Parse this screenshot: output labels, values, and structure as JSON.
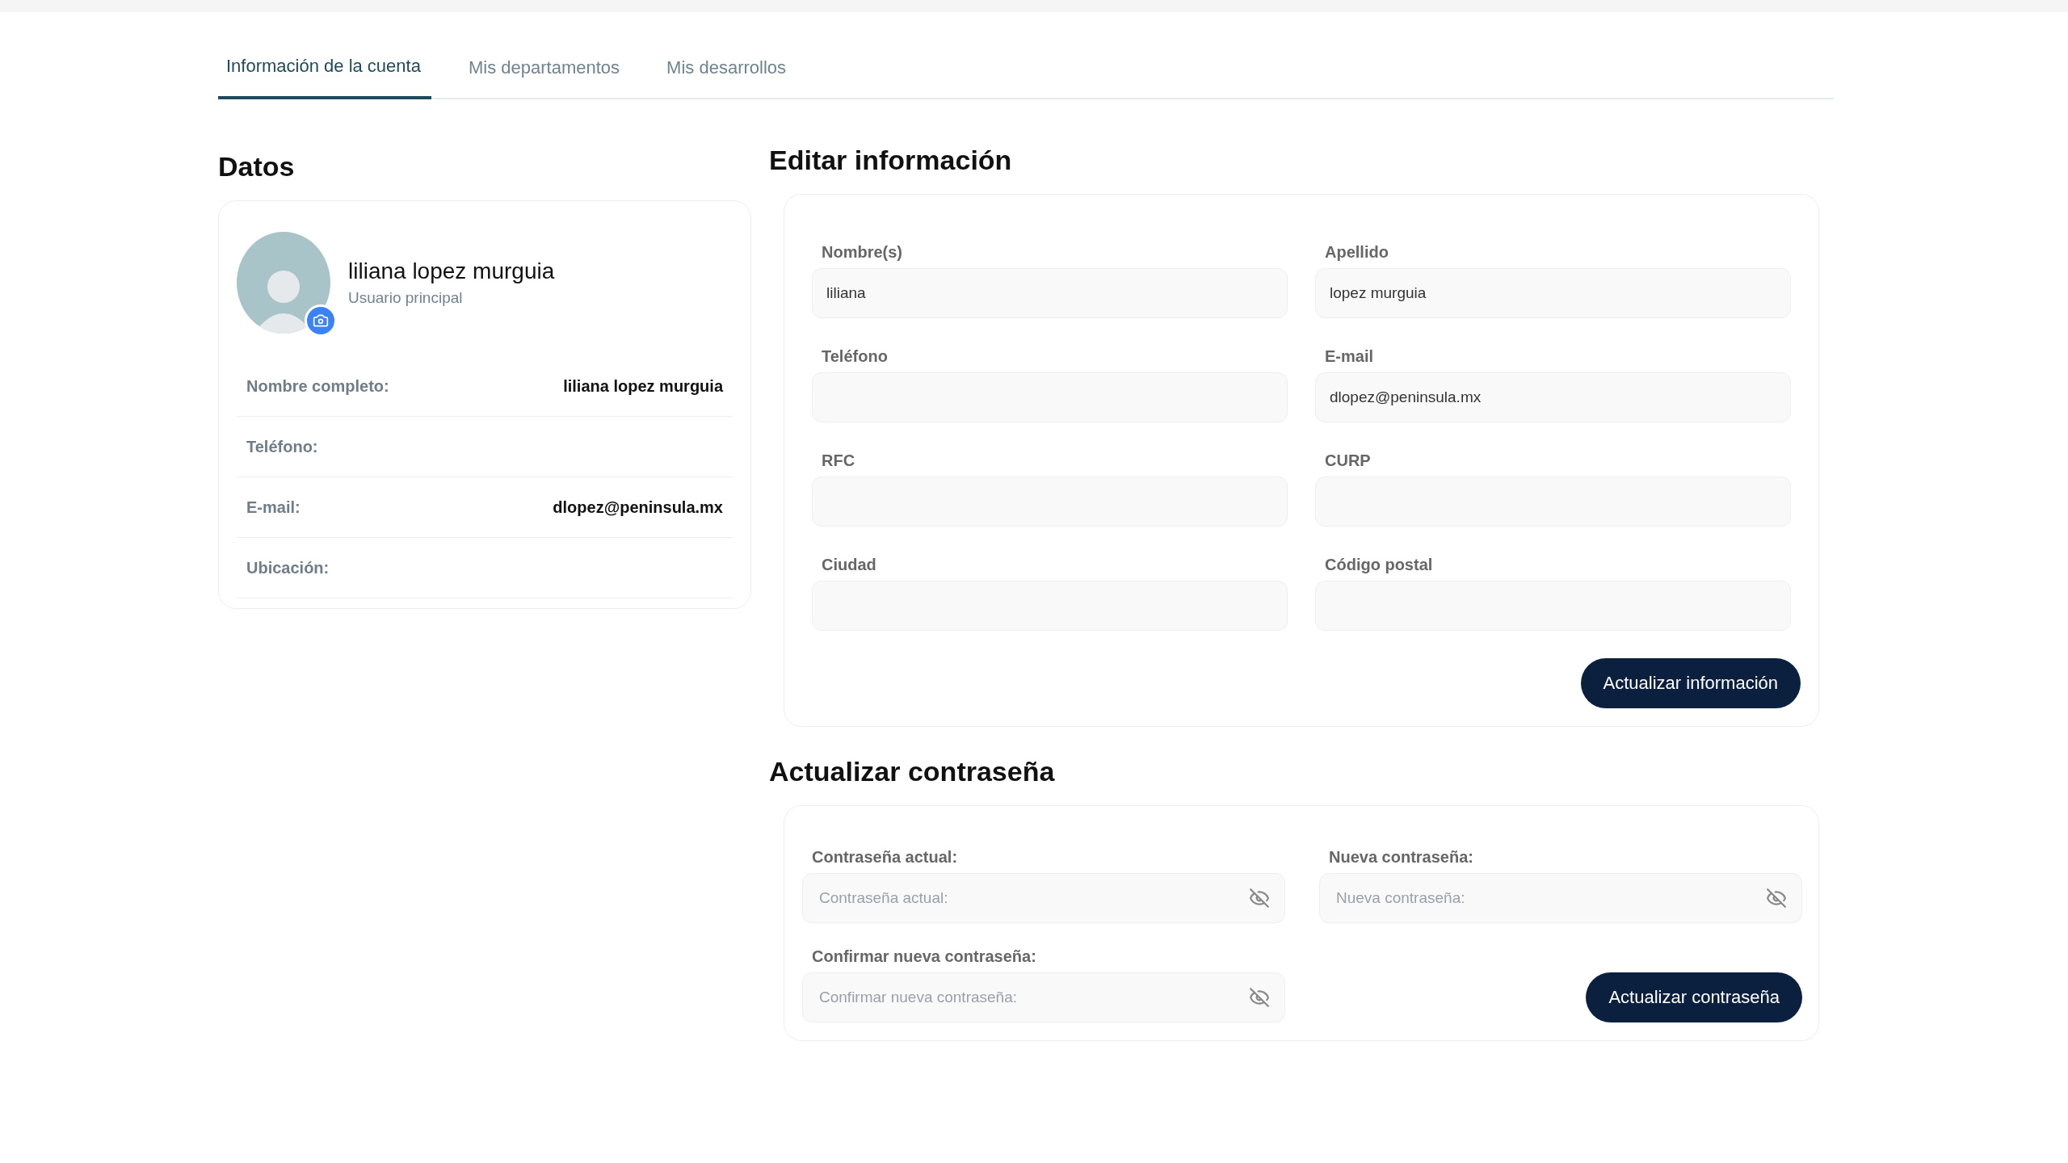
{
  "tabs": [
    {
      "label": "Información de la cuenta",
      "selected": true
    },
    {
      "label": "Mis departamentos",
      "selected": false
    },
    {
      "label": "Mis desarrollos",
      "selected": false
    }
  ],
  "profile": {
    "heading": "Datos",
    "name": "liliana lopez murguia",
    "role": "Usuario principal",
    "rows": [
      {
        "label": "Nombre completo:",
        "value": "liliana lopez murguia"
      },
      {
        "label": "Teléfono:"
      },
      {
        "label": "E-mail:",
        "value": "dlopez@peninsula.mx"
      },
      {
        "label": "Ubicación:"
      }
    ]
  },
  "edit": {
    "heading": "Editar información",
    "fields": [
      {
        "label": "Nombre(s)",
        "value": "liliana"
      },
      {
        "label": "Apellido",
        "value": "lopez murguia"
      },
      {
        "label": "Teléfono"
      },
      {
        "label": "E-mail",
        "value": "dlopez@peninsula.mx"
      },
      {
        "label": "RFC"
      },
      {
        "label": "CURP"
      },
      {
        "label": "Ciudad"
      },
      {
        "label": "Código postal"
      }
    ],
    "button": "Actualizar información"
  },
  "password": {
    "heading": "Actualizar contraseña",
    "fields": [
      {
        "label": "Contraseña actual:",
        "placeholder": "Contraseña actual:"
      },
      {
        "label": "Nueva contraseña:",
        "placeholder": "Nueva contraseña:"
      },
      {
        "label": "Confirmar nueva contraseña:",
        "placeholder": "Confirmar nueva contraseña:"
      }
    ],
    "button": "Actualizar contraseña"
  }
}
